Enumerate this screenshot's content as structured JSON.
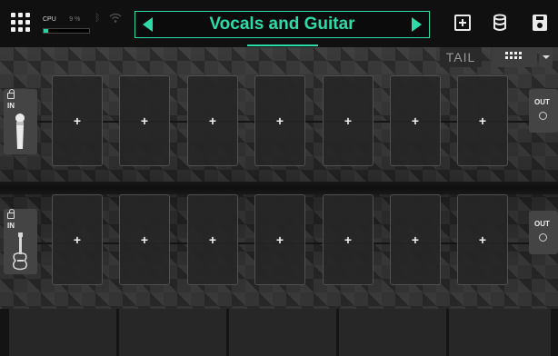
{
  "topbar": {
    "cpu_label": "CPU",
    "cpu_value": "9 %",
    "cpu_percent": 9,
    "accent_color": "#2ddba9",
    "preset_name": "Vocals and Guitar",
    "icons": [
      "grid-menu-icon",
      "bluetooth-icon",
      "wifi-icon",
      "add-block-icon",
      "preset-library-icon",
      "save-icon"
    ]
  },
  "toolbar": {
    "tail_label": "TAIL",
    "layout_icon": "grid-layout-icon"
  },
  "lanes": [
    {
      "input_label": "IN",
      "input_icon": "microphone-icon",
      "output_label": "OUT",
      "slots": [
        "+",
        "+",
        "+",
        "+",
        "+",
        "+",
        "+"
      ]
    },
    {
      "input_label": "IN",
      "input_icon": "guitar-icon",
      "output_label": "OUT",
      "slots": [
        "+",
        "+",
        "+",
        "+",
        "+",
        "+",
        "+"
      ]
    }
  ],
  "footswitches": 5
}
